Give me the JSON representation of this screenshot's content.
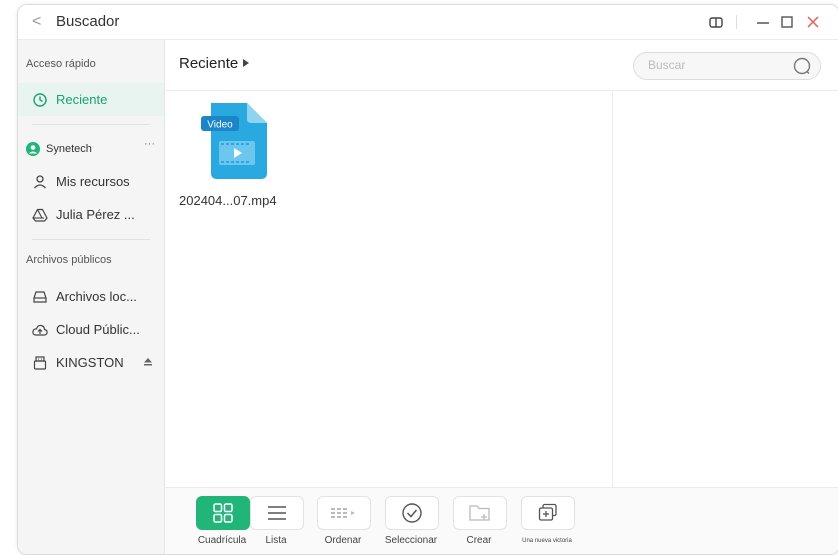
{
  "window": {
    "title": "Buscador",
    "back_icon": "chevron-left-icon",
    "controls": [
      "split-view-icon",
      "minimize-icon",
      "maximize-icon",
      "close-icon"
    ],
    "close_color": "#e35d5d"
  },
  "sidebar": {
    "quick_access_label": "Acceso rápido",
    "recent_label": "Reciente",
    "account_name": "Synetech",
    "account_more": "···",
    "my_resources": "Mis recursos",
    "drive": "Julia Pérez ...",
    "public_label": "Archivos públicos",
    "local_files": "Archivos loc...",
    "public_cloud": "Cloud Públic...",
    "usb_drive": "KINGSTON",
    "accent": "#1aa272"
  },
  "main": {
    "breadcrumb": "Reciente",
    "search_placeholder": "Buscar",
    "files": [
      {
        "badge": "Video",
        "name": "202404...07.mp4",
        "icon": "video-file-icon",
        "color": "#29a8e0"
      }
    ]
  },
  "toolbar": {
    "grid": "Cuadrícula",
    "list": "Lista",
    "sort": "Ordenar",
    "select": "Seleccionar",
    "create": "Crear",
    "new_window": "Una nueva victoria",
    "active_color": "#22b579"
  }
}
